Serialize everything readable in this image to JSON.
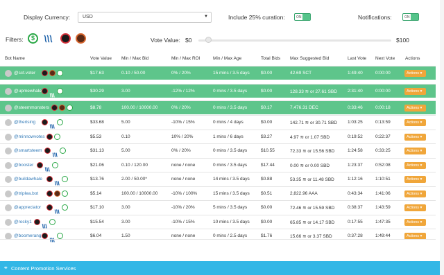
{
  "header": {
    "currency_label": "Display Currency:",
    "currency_value": "USD",
    "curation_label": "Include 25% curation:",
    "curation_toggle": "ON",
    "notifications_label": "Notifications:",
    "notifications_toggle": "ON",
    "filters_label": "Filters:",
    "vote_value_label": "Vote Value:",
    "vote_min": "$0",
    "vote_max": "$100",
    "vote_slider_level_percent": 4
  },
  "table": {
    "columns": [
      "Bot Name",
      "Vote Value",
      "Min / Max Bid",
      "Min / Max ROI",
      "Min / Max Age",
      "Total Bids",
      "Max Suggested Bid",
      "Last Vote",
      "Next Vote",
      "Actions"
    ],
    "action_label": "Actions ▾",
    "rows": [
      {
        "name": "@sct.voter",
        "vote": "$17.63",
        "bid": "0.10 / 50.00",
        "roi": "0% / 20%",
        "age": "15 mins / 3.5 days",
        "total": "$0.00",
        "maxbid": "42.69 SCT",
        "last": "1:49:40",
        "next": "0:00:00",
        "green": true,
        "badges": [
          "rc",
          "vp",
          "ds"
        ]
      },
      {
        "name": "@upmewhale",
        "vote": "$30.29",
        "bid": "3.00",
        "roi": "-12% / 12%",
        "age": "0 mins / 3.5 days",
        "total": "$0.00",
        "maxbid": "128.33 ≋ or 27.61 SBD",
        "last": "2:31:40",
        "next": "0:00:00",
        "green": true,
        "badges": [
          "rc",
          "st",
          "ds"
        ]
      },
      {
        "name": "@steemmonsters",
        "vote": "$8.78",
        "bid": "100.00 / 10000.00",
        "roi": "0% / 20%",
        "age": "0 mins / 3.5 days",
        "total": "$0.17",
        "maxbid": "7,476.31 DEC",
        "last": "0:33:46",
        "next": "0:00:18",
        "green": true,
        "badges": [
          "rc",
          "vp",
          "ds"
        ]
      },
      {
        "name": "@therising",
        "vote": "$33.68",
        "bid": "5.00",
        "roi": "-10% / 15%",
        "age": "0 mins / 4 days",
        "total": "$0.00",
        "maxbid": "142.71 ≋ or 30.71 SBD",
        "last": "1:03:25",
        "next": "0:13:59",
        "green": false,
        "badges": [
          "rc",
          "st",
          "ds"
        ]
      },
      {
        "name": "@minnowvotes",
        "vote": "$5.53",
        "bid": "0.10",
        "roi": "10% / 20%",
        "age": "1 mins / 6 days",
        "total": "$3.27",
        "maxbid": "4.97 ≋ or 1.07 SBD",
        "last": "0:19:52",
        "next": "0:22:37",
        "green": false,
        "badges": [
          "rc",
          "ds"
        ]
      },
      {
        "name": "@smartsteem",
        "vote": "$31.13",
        "bid": "5.00",
        "roi": "0% / 20%",
        "age": "0 mins / 3.5 days",
        "total": "$10.55",
        "maxbid": "72.33 ≋ or 15.56 SBD",
        "last": "1:24:58",
        "next": "0:33:25",
        "green": false,
        "badges": [
          "rc",
          "st",
          "ds"
        ]
      },
      {
        "name": "@booster",
        "vote": "$21.06",
        "bid": "0.10 / 120.00",
        "roi": "none / none",
        "age": "0 mins / 3.5 days",
        "total": "$17.44",
        "maxbid": "0.00 ≋ or 0.00 SBD",
        "last": "1:23:37",
        "next": "0:52:08",
        "green": false,
        "badges": [
          "rc",
          "st",
          "ds"
        ]
      },
      {
        "name": "@buildawhale",
        "vote": "$13.76",
        "bid": "2.00 / 50.00*",
        "roi": "none / none",
        "age": "14 mins / 3.5 days",
        "total": "$0.88",
        "maxbid": "53.35 ≋ or 11.48 SBD",
        "last": "1:12:16",
        "next": "1:10:51",
        "green": false,
        "badges": [
          "rc",
          "st",
          "ds"
        ]
      },
      {
        "name": "@triplea.bot",
        "vote": "$5.14",
        "bid": "100.00 / 10000.00",
        "roi": "-10% / 100%",
        "age": "15 mins / 3.5 days",
        "total": "$0.51",
        "maxbid": "2,822.96 AAA",
        "last": "0:43:34",
        "next": "1:41:06",
        "green": false,
        "badges": [
          "rc",
          "vp",
          "ds"
        ]
      },
      {
        "name": "@appreciator",
        "vote": "$17.10",
        "bid": "3.00",
        "roi": "-10% / 20%",
        "age": "5 mins / 3.5 days",
        "total": "$0.00",
        "maxbid": "72.46 ≋ or 15.59 SBD",
        "last": "0:38:37",
        "next": "1:43:59",
        "green": false,
        "badges": [
          "rc",
          "st",
          "ds"
        ]
      },
      {
        "name": "@rocky1",
        "vote": "$15.54",
        "bid": "3.00",
        "roi": "-10% / 15%",
        "age": "10 mins / 3.5 days",
        "total": "$0.00",
        "maxbid": "65.85 ≋ or 14.17 SBD",
        "last": "0:17:55",
        "next": "1:47:35",
        "green": false,
        "badges": [
          "rc",
          "st",
          "ds"
        ]
      },
      {
        "name": "@boomerang",
        "vote": "$6.04",
        "bid": "1.50",
        "roi": "none / none",
        "age": "0 mins / 2.5 days",
        "total": "$1.76",
        "maxbid": "15.66 ≋ or 3.37 SBD",
        "last": "0:37:28",
        "next": "1:49:44",
        "green": false,
        "badges": [
          "cm",
          "st",
          "ds"
        ]
      }
    ]
  },
  "footer": {
    "promo_label": "Content Promotion Services"
  },
  "colors": {
    "highlight_green": "#5ec58b",
    "action_orange": "#f0a63a",
    "link_blue": "#337ab7",
    "promo_blue": "#33b7e6"
  }
}
